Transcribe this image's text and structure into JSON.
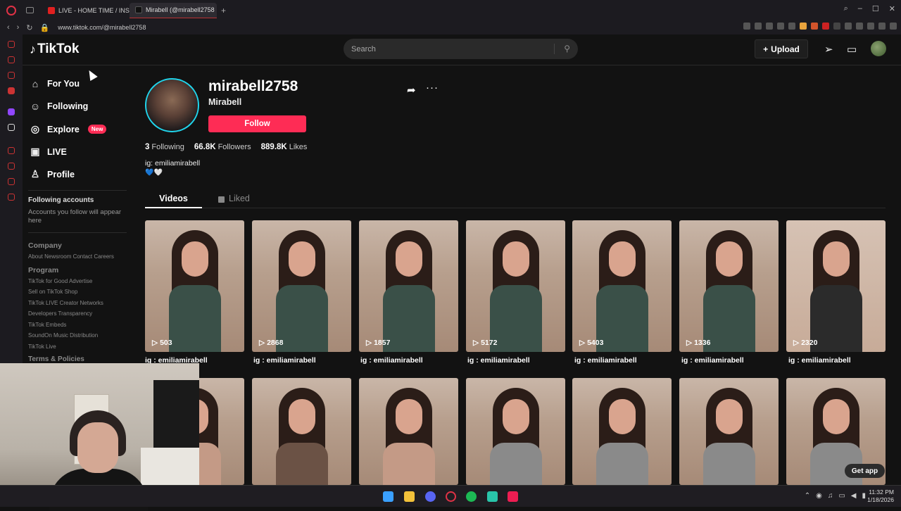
{
  "browser": {
    "tabs": [
      {
        "label": "LIVE - HOME TIME / INSTA",
        "icon": "youtube-icon"
      },
      {
        "label": "Mirabell (@mirabell2758",
        "icon": "tiktok-icon"
      }
    ],
    "new_tab": "+",
    "url": "www.tiktok.com/@mirabell2758"
  },
  "header": {
    "logo_text": "TikTok",
    "search_placeholder": "Search",
    "upload_label": "Upload"
  },
  "nav": {
    "items": [
      {
        "label": "For You",
        "icon": "home-icon"
      },
      {
        "label": "Following",
        "icon": "users-icon"
      },
      {
        "label": "Explore",
        "icon": "compass-icon",
        "badge": "New"
      },
      {
        "label": "LIVE",
        "icon": "live-icon"
      },
      {
        "label": "Profile",
        "icon": "person-icon"
      }
    ],
    "following_title": "Following accounts",
    "following_sub": "Accounts you follow will appear here",
    "company": "Company",
    "company_links": "About  Newsroom  Contact  Careers",
    "program": "Program",
    "program_links": [
      "TikTok for Good  Advertise",
      "Sell on TikTok Shop",
      "TikTok LIVE Creator Networks",
      "Developers  Transparency",
      "TikTok Embeds",
      "SoundOn Music Distribution",
      "TikTok Live"
    ],
    "terms": "Terms & Policies"
  },
  "profile": {
    "username": "mirabell2758",
    "nickname": "Mirabell",
    "follow_label": "Follow",
    "following_count": "3",
    "following_label": "Following",
    "followers_count": "66.8K",
    "followers_label": "Followers",
    "likes_count": "889.8K",
    "likes_label": "Likes",
    "bio_line1": "ig: emiliamirabell",
    "bio_line2": "💙🤍"
  },
  "tabs": {
    "videos": "Videos",
    "liked": "Liked"
  },
  "videos": [
    {
      "views": "503",
      "caption": "ig : emiliamirabell"
    },
    {
      "views": "2868",
      "caption": "ig : emiliamirabell"
    },
    {
      "views": "1857",
      "caption": "ig : emiliamirabell"
    },
    {
      "views": "5172",
      "caption": "ig : emiliamirabell"
    },
    {
      "views": "5403",
      "caption": "ig : emiliamirabell"
    },
    {
      "views": "1336",
      "caption": "ig : emiliamirabell"
    },
    {
      "views": "2320",
      "caption": "ig : emiliamirabell"
    }
  ],
  "get_app": "Get app",
  "clock": {
    "time": "11:32 PM",
    "date": "1/18/2026"
  },
  "colors": {
    "accent": "#fe2c55",
    "avatar_ring": "#20d5ec"
  }
}
